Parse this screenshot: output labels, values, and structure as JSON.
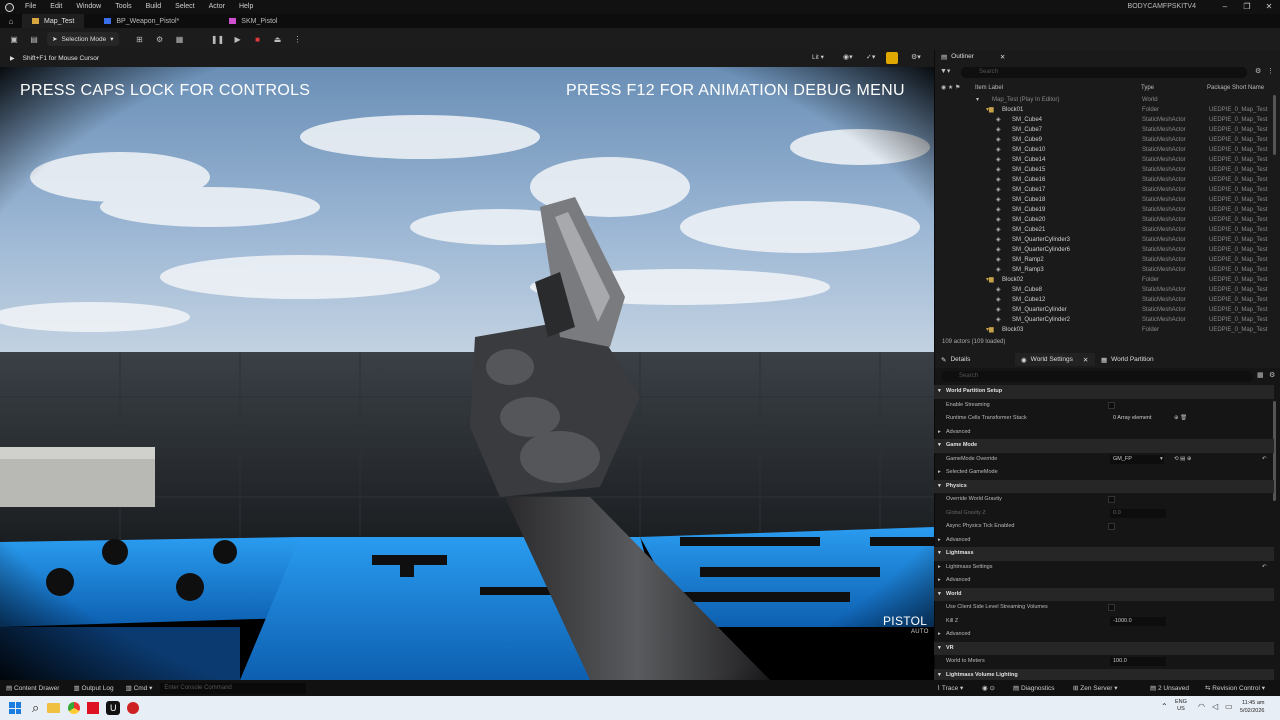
{
  "menu": {
    "items": [
      "File",
      "Edit",
      "Window",
      "Tools",
      "Build",
      "Select",
      "Actor",
      "Help"
    ],
    "project": "BODYCAMFPSKITV4"
  },
  "tabs": [
    {
      "label": "Map_Test"
    },
    {
      "label": "BP_Weapon_Pistol*"
    },
    {
      "label": "SKM_Pistol"
    }
  ],
  "toolbar": {
    "mode": "Selection Mode"
  },
  "viewport": {
    "hint": "Shift+F1 for Mouse Cursor",
    "lit": "Lit",
    "hud_left": "PRESS CAPS LOCK FOR CONTROLS",
    "hud_right": "PRESS F12 FOR ANIMATION DEBUG MENU",
    "weapon_name": "PISTOL",
    "weapon_mode": "AUTO"
  },
  "outliner": {
    "title": "Outliner",
    "search_placeholder": "Search",
    "col_label": "Item Label",
    "col_type": "Type",
    "col_package": "Package Short Name",
    "footer": "109 actors (109 loaded)",
    "rows": [
      {
        "label": "Map_Test (Play In Editor)",
        "type": "World",
        "pkg": "",
        "indent": 0,
        "folder": false,
        "world": true
      },
      {
        "label": "Block01",
        "type": "Folder",
        "pkg": "UEDPIE_0_Map_Test",
        "indent": 1,
        "folder": true
      },
      {
        "label": "SM_Cube4",
        "type": "StaticMeshActor",
        "pkg": "UEDPIE_0_Map_Test",
        "indent": 2
      },
      {
        "label": "SM_Cube7",
        "type": "StaticMeshActor",
        "pkg": "UEDPIE_0_Map_Test",
        "indent": 2
      },
      {
        "label": "SM_Cube9",
        "type": "StaticMeshActor",
        "pkg": "UEDPIE_0_Map_Test",
        "indent": 2
      },
      {
        "label": "SM_Cube10",
        "type": "StaticMeshActor",
        "pkg": "UEDPIE_0_Map_Test",
        "indent": 2
      },
      {
        "label": "SM_Cube14",
        "type": "StaticMeshActor",
        "pkg": "UEDPIE_0_Map_Test",
        "indent": 2
      },
      {
        "label": "SM_Cube15",
        "type": "StaticMeshActor",
        "pkg": "UEDPIE_0_Map_Test",
        "indent": 2
      },
      {
        "label": "SM_Cube16",
        "type": "StaticMeshActor",
        "pkg": "UEDPIE_0_Map_Test",
        "indent": 2
      },
      {
        "label": "SM_Cube17",
        "type": "StaticMeshActor",
        "pkg": "UEDPIE_0_Map_Test",
        "indent": 2
      },
      {
        "label": "SM_Cube18",
        "type": "StaticMeshActor",
        "pkg": "UEDPIE_0_Map_Test",
        "indent": 2
      },
      {
        "label": "SM_Cube19",
        "type": "StaticMeshActor",
        "pkg": "UEDPIE_0_Map_Test",
        "indent": 2
      },
      {
        "label": "SM_Cube20",
        "type": "StaticMeshActor",
        "pkg": "UEDPIE_0_Map_Test",
        "indent": 2
      },
      {
        "label": "SM_Cube21",
        "type": "StaticMeshActor",
        "pkg": "UEDPIE_0_Map_Test",
        "indent": 2
      },
      {
        "label": "SM_QuarterCylinder3",
        "type": "StaticMeshActor",
        "pkg": "UEDPIE_0_Map_Test",
        "indent": 2
      },
      {
        "label": "SM_QuarterCylinder6",
        "type": "StaticMeshActor",
        "pkg": "UEDPIE_0_Map_Test",
        "indent": 2
      },
      {
        "label": "SM_Ramp2",
        "type": "StaticMeshActor",
        "pkg": "UEDPIE_0_Map_Test",
        "indent": 2
      },
      {
        "label": "SM_Ramp3",
        "type": "StaticMeshActor",
        "pkg": "UEDPIE_0_Map_Test",
        "indent": 2
      },
      {
        "label": "Block02",
        "type": "Folder",
        "pkg": "UEDPIE_0_Map_Test",
        "indent": 1,
        "folder": true
      },
      {
        "label": "SM_Cube8",
        "type": "StaticMeshActor",
        "pkg": "UEDPIE_0_Map_Test",
        "indent": 2
      },
      {
        "label": "SM_Cube12",
        "type": "StaticMeshActor",
        "pkg": "UEDPIE_0_Map_Test",
        "indent": 2
      },
      {
        "label": "SM_QuarterCylinder",
        "type": "StaticMeshActor",
        "pkg": "UEDPIE_0_Map_Test",
        "indent": 2
      },
      {
        "label": "SM_QuarterCylinder2",
        "type": "StaticMeshActor",
        "pkg": "UEDPIE_0_Map_Test",
        "indent": 2
      },
      {
        "label": "Block03",
        "type": "Folder",
        "pkg": "UEDPIE_0_Map_Test",
        "indent": 1,
        "folder": true
      }
    ]
  },
  "details": {
    "tabs": [
      "Details",
      "World Settings",
      "World Partition"
    ],
    "search_placeholder": "Search",
    "rows": [
      {
        "kind": "cat",
        "label": "World Partition Setup"
      },
      {
        "kind": "prop",
        "label": "Enable Streaming",
        "value": "",
        "check": true
      },
      {
        "kind": "prop",
        "label": "Runtime Cells Transformer Stack",
        "value": "0 Array element",
        "icons": true
      },
      {
        "kind": "sub",
        "label": "Advanced"
      },
      {
        "kind": "cat",
        "label": "Game Mode"
      },
      {
        "kind": "prop",
        "label": "GameMode Override",
        "value": "GM_FP",
        "dropdown": true
      },
      {
        "kind": "sub",
        "label": "Selected GameMode"
      },
      {
        "kind": "cat",
        "label": "Physics"
      },
      {
        "kind": "prop",
        "label": "Override World Gravity",
        "value": "",
        "check": true
      },
      {
        "kind": "prop",
        "label": "Global Gravity Z",
        "value": "0.0",
        "dim": true,
        "field": true
      },
      {
        "kind": "prop",
        "label": "Async Physics Tick Enabled",
        "value": "",
        "check": true
      },
      {
        "kind": "sub",
        "label": "Advanced"
      },
      {
        "kind": "cat",
        "label": "Lightmass"
      },
      {
        "kind": "sub",
        "label": "Lightmass Settings"
      },
      {
        "kind": "sub",
        "label": "Advanced"
      },
      {
        "kind": "cat",
        "label": "World"
      },
      {
        "kind": "prop",
        "label": "Use Client Side Level Streaming Volumes",
        "value": "",
        "check": true
      },
      {
        "kind": "prop",
        "label": "Kill Z",
        "value": "-1000.0",
        "field": true
      },
      {
        "kind": "sub",
        "label": "Advanced"
      },
      {
        "kind": "cat",
        "label": "VR"
      },
      {
        "kind": "prop",
        "label": "World to Meters",
        "value": "100.0",
        "field": true
      },
      {
        "kind": "cat",
        "label": "Lightmass Volume Lighting"
      }
    ]
  },
  "statusbar": {
    "content_drawer": "Content Drawer",
    "output_log": "Output Log",
    "cmd": "Cmd",
    "console_placeholder": "Enter Console Command",
    "trace": "Trace",
    "diagnostics": "Diagnostics",
    "zen": "Zen Server",
    "unsaved": "2 Unsaved",
    "revision": "Revision Control"
  },
  "taskbar": {
    "lang1": "ENG",
    "lang2": "US",
    "time": "11:45 am",
    "date": "5/02/2026"
  },
  "colors": {
    "accent": "#e0a800",
    "blue_table": "#1a8fe0",
    "folder": "#c8a24a"
  }
}
